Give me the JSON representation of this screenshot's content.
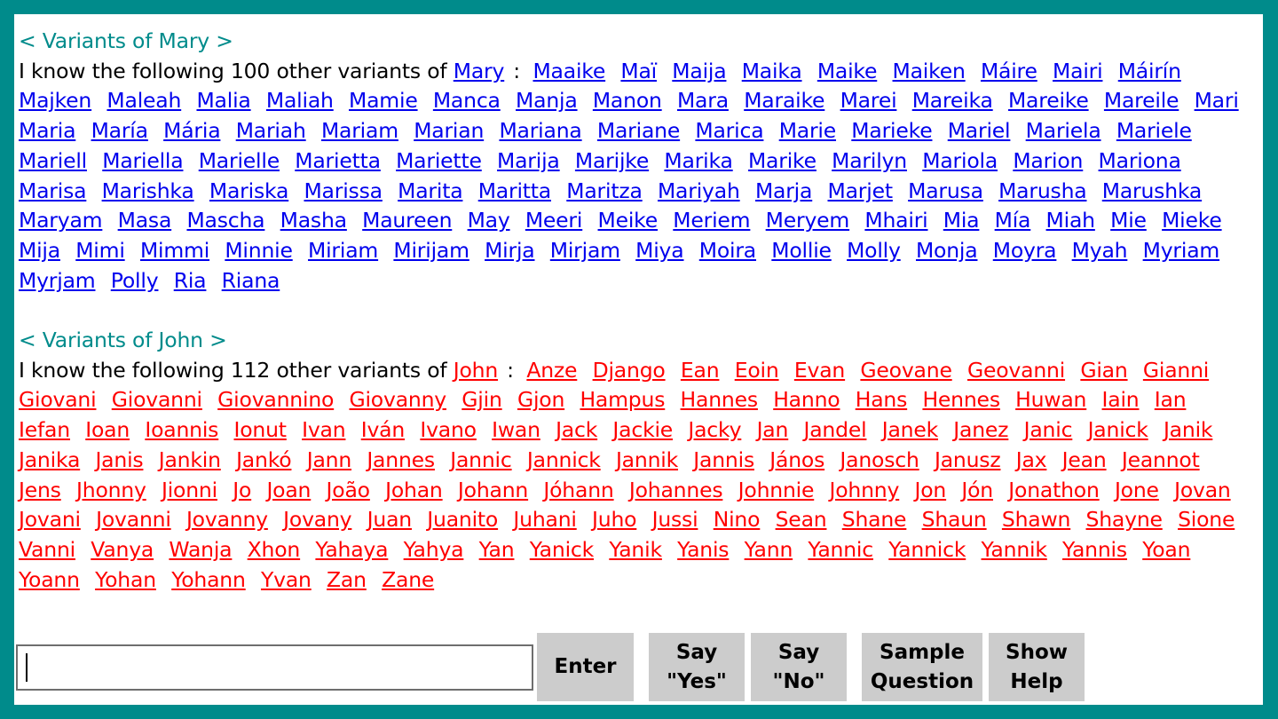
{
  "mary": {
    "title": "< Variants of Mary >",
    "intro": "I know the following 100 other variants of ",
    "name": "Mary",
    "sep": ":  ",
    "variants": [
      "Maaike",
      "Maï",
      "Maija",
      "Maika",
      "Maike",
      "Maiken",
      "Máire",
      "Mairi",
      "Máirín",
      "Majken",
      "Maleah",
      "Malia",
      "Maliah",
      "Mamie",
      "Manca",
      "Manja",
      "Manon",
      "Mara",
      "Maraike",
      "Marei",
      "Mareika",
      "Mareike",
      "Mareile",
      "Mari",
      "Maria",
      "María",
      "Mária",
      "Mariah",
      "Mariam",
      "Marian",
      "Mariana",
      "Mariane",
      "Marica",
      "Marie",
      "Marieke",
      "Mariel",
      "Mariela",
      "Mariele",
      "Mariell",
      "Mariella",
      "Marielle",
      "Marietta",
      "Mariette",
      "Marija",
      "Marijke",
      "Marika",
      "Marike",
      "Marilyn",
      "Mariola",
      "Marion",
      "Mariona",
      "Marisa",
      "Marishka",
      "Mariska",
      "Marissa",
      "Marita",
      "Maritta",
      "Maritza",
      "Mariyah",
      "Marja",
      "Marjet",
      "Marusa",
      "Marusha",
      "Marushka",
      "Maryam",
      "Masa",
      "Mascha",
      "Masha",
      "Maureen",
      "May",
      "Meeri",
      "Meike",
      "Meriem",
      "Meryem",
      "Mhairi",
      "Mia",
      "Mía",
      "Miah",
      "Mie",
      "Mieke",
      "Mija",
      "Mimi",
      "Mimmi",
      "Minnie",
      "Miriam",
      "Mirijam",
      "Mirja",
      "Mirjam",
      "Miya",
      "Moira",
      "Mollie",
      "Molly",
      "Monja",
      "Moyra",
      "Myah",
      "Myriam",
      "Myrjam",
      "Polly",
      "Ria",
      "Riana"
    ]
  },
  "john": {
    "title": "< Variants of John >",
    "intro": "I know the following 112 other variants of ",
    "name": "John",
    "sep": ":  ",
    "variants": [
      "Anze",
      "Django",
      "Ean",
      "Eoin",
      "Evan",
      "Geovane",
      "Geovanni",
      "Gian",
      "Gianni",
      "Giovani",
      "Giovanni",
      "Giovannino",
      "Giovanny",
      "Gjin",
      "Gjon",
      "Hampus",
      "Hannes",
      "Hanno",
      "Hans",
      "Hennes",
      "Huwan",
      "Iain",
      "Ian",
      "Iefan",
      "Ioan",
      "Ioannis",
      "Ionut",
      "Ivan",
      "Iván",
      "Ivano",
      "Iwan",
      "Jack",
      "Jackie",
      "Jacky",
      "Jan",
      "Jandel",
      "Janek",
      "Janez",
      "Janic",
      "Janick",
      "Janik",
      "Janika",
      "Janis",
      "Jankin",
      "Jankó",
      "Jann",
      "Jannes",
      "Jannic",
      "Jannick",
      "Jannik",
      "Jannis",
      "János",
      "Janosch",
      "Janusz",
      "Jax",
      "Jean",
      "Jeannot",
      "Jens",
      "Jhonny",
      "Jionni",
      "Jo",
      "Joan",
      "João",
      "Johan",
      "Johann",
      "Jóhann",
      "Johannes",
      "Johnnie",
      "Johnny",
      "Jon",
      "Jón",
      "Jonathon",
      "Jone",
      "Jovan",
      "Jovani",
      "Jovanni",
      "Jovanny",
      "Jovany",
      "Juan",
      "Juanito",
      "Juhani",
      "Juho",
      "Jussi",
      "Nino",
      "Sean",
      "Shane",
      "Shaun",
      "Shawn",
      "Shayne",
      "Sione",
      "Vanni",
      "Vanya",
      "Wanja",
      "Xhon",
      "Yahaya",
      "Yahya",
      "Yan",
      "Yanick",
      "Yanik",
      "Yanis",
      "Yann",
      "Yannic",
      "Yannick",
      "Yannik",
      "Yannis",
      "Yoan",
      "Yoann",
      "Yohan",
      "Yohann",
      "Yvan",
      "Zan",
      "Zane"
    ]
  },
  "input": {
    "value": ""
  },
  "buttons": {
    "enter": "Enter",
    "say_yes": "Say\n\"Yes\"",
    "say_no": "Say\n\"No\"",
    "sample_question": "Sample\nQuestion",
    "show_help": "Show\nHelp"
  },
  "colors": {
    "frame": "#008b8b",
    "mary_links": "#0000ee",
    "john_links": "#ff0000",
    "button_bg": "#cccccc"
  }
}
